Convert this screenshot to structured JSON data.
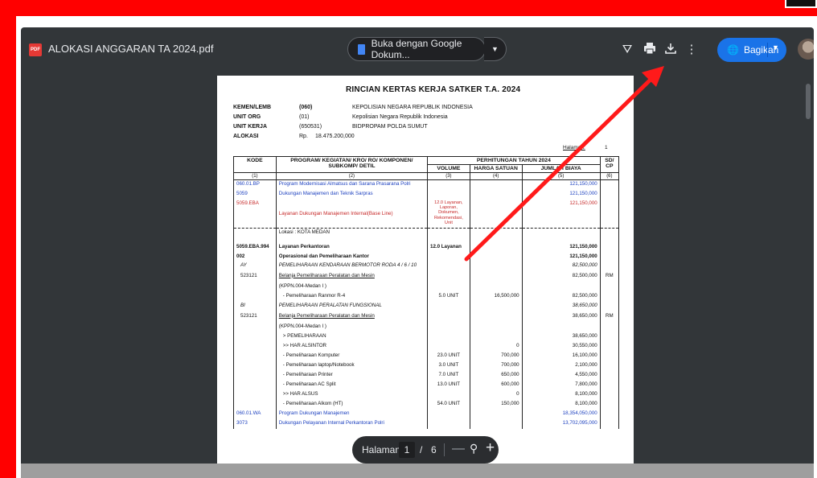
{
  "viewer": {
    "file_name": "ALOKASI ANGGARAN TA 2024.pdf",
    "open_with_label": "Buka dengan Google Dokum...",
    "share_label": "Bagikan",
    "icons": [
      "pdf-icon",
      "add-to-drive-icon",
      "print-icon",
      "download-icon",
      "more-vert-icon",
      "globe-icon",
      "avatar"
    ]
  },
  "pager": {
    "label": "Halaman",
    "current": "1",
    "separator": "/",
    "total": "6",
    "minus": "—",
    "zoom": "⚲",
    "plus": "+"
  },
  "document": {
    "title": "RINCIAN KERTAS KERJA SATKER T.A. 2024",
    "meta": [
      {
        "key": "KEMEN/LEMB",
        "code": "(060)",
        "value": "KEPOLISIAN NEGARA REPUBLIK INDONESIA"
      },
      {
        "key": "UNIT ORG",
        "code": "(01)",
        "value": "Kepolisian Negara Republik Indonesia"
      },
      {
        "key": "UNIT KERJA",
        "code": "(650531)",
        "value": "BIDPROPAM POLDA SUMUT"
      },
      {
        "key": "ALOKASI",
        "code": "Rp.",
        "value": "18.475.200,000"
      }
    ],
    "halaman_label": "Halaman:",
    "halaman_value": "1",
    "headers": {
      "kode": "KODE",
      "program": "PROGRAM/ KEGIATAN/ KRO/ RO/ KOMPONEN/ SUBKOMP/ DETIL",
      "perhitungan": "PERHITUNGAN TAHUN 2024",
      "volume": "VOLUME",
      "harga": "HARGA SATUAN",
      "jumlah": "JUMLAH BIAYA",
      "sdcp": "SD/ CP"
    },
    "col_numbers": [
      "(1)",
      "(2)",
      "(3)",
      "(4)",
      "(5)",
      "(6)"
    ],
    "rows": [
      {
        "kode": "060.01.BP",
        "program": "Program Modernisasi Almatsus dan Sarana Prasarana Polri",
        "volume": "",
        "harga": "",
        "jumlah": "121,150,000",
        "sd": ""
      },
      {
        "kode": "5059",
        "program": "Dukungan Manajemen dan Teknik Sarpras",
        "volume": "",
        "harga": "",
        "jumlah": "121,150,000",
        "sd": ""
      },
      {
        "kode": "5059.EBA",
        "program": "Layanan Dukungan Manajemen Internal(Base Line)",
        "volume": "12.0 Layanan, Laporan, Dokumen, Rekomendasi, Unit",
        "harga": "",
        "jumlah": "121,150,000",
        "sd": ""
      },
      {
        "kode": "",
        "program": "Lokasi : KOTA MEDAN",
        "volume": "",
        "harga": "",
        "jumlah": "",
        "sd": ""
      },
      {
        "kode": "5059.EBA.994",
        "program": "Layanan Perkantoran",
        "volume": "12.0 Layanan",
        "harga": "",
        "jumlah": "121,150,000",
        "sd": ""
      },
      {
        "kode": "002",
        "program": "Operasional dan Pemeliharaan Kantor",
        "volume": "",
        "harga": "",
        "jumlah": "121,150,000",
        "sd": ""
      },
      {
        "kode": "AY",
        "program": "PEMELIHARAAN KENDARAAN BERMOTOR RODA 4 / 6 / 10",
        "volume": "",
        "harga": "",
        "jumlah": "82,500,000",
        "sd": ""
      },
      {
        "kode": "523121",
        "program": "Belanja Pemeliharaan Peralatan dan Mesin",
        "volume": "",
        "harga": "",
        "jumlah": "82,500,000",
        "sd": "RM"
      },
      {
        "kode": "",
        "program": "(KPPN.004-Medan I )",
        "volume": "",
        "harga": "",
        "jumlah": "",
        "sd": ""
      },
      {
        "kode": "",
        "program": "-  Pemeliharaan Ranmor R-4",
        "volume": "5.0 UNIT",
        "harga": "16,500,000",
        "jumlah": "82,500,000",
        "sd": ""
      },
      {
        "kode": "BI",
        "program": "PEMELIHARAAN PERALATAN FUNGSIONAL",
        "volume": "",
        "harga": "",
        "jumlah": "38,650,000",
        "sd": ""
      },
      {
        "kode": "523121",
        "program": "Belanja Pemeliharaan Peralatan dan Mesin",
        "volume": "",
        "harga": "",
        "jumlah": "38,650,000",
        "sd": "RM"
      },
      {
        "kode": "",
        "program": "(KPPN.004-Medan I )",
        "volume": "",
        "harga": "",
        "jumlah": "",
        "sd": ""
      },
      {
        "kode": "",
        "program": ">   PEMELIHARAAN",
        "volume": "",
        "harga": "",
        "jumlah": "38,650,000",
        "sd": ""
      },
      {
        "kode": "",
        "program": ">>  HAR ALSINTOR",
        "volume": "",
        "harga": "0",
        "jumlah": "30,550,000",
        "sd": ""
      },
      {
        "kode": "",
        "program": "-  Pemeliharaan Komputer",
        "volume": "23.0 UNIT",
        "harga": "700,000",
        "jumlah": "16,100,000",
        "sd": ""
      },
      {
        "kode": "",
        "program": "-  Pemeliharaan laptop/Notebook",
        "volume": "3.0 UNIT",
        "harga": "700,000",
        "jumlah": "2,100,000",
        "sd": ""
      },
      {
        "kode": "",
        "program": "-  Pemeliharaan Printer",
        "volume": "7.0 UNIT",
        "harga": "650,000",
        "jumlah": "4,550,000",
        "sd": ""
      },
      {
        "kode": "",
        "program": "-  Pemeliharaan AC Split",
        "volume": "13.0 UNIT",
        "harga": "600,000",
        "jumlah": "7,800,000",
        "sd": ""
      },
      {
        "kode": "",
        "program": ">>  HAR ALSUS",
        "volume": "",
        "harga": "0",
        "jumlah": "8,100,000",
        "sd": ""
      },
      {
        "kode": "",
        "program": "-  Pemeliharaan Alkom (HT)",
        "volume": "54.0 UNIT",
        "harga": "150,000",
        "jumlah": "8,100,000",
        "sd": ""
      },
      {
        "kode": "060.01.WA",
        "program": "Program Dukungan Manajemen",
        "volume": "",
        "harga": "",
        "jumlah": "18,354,050,000",
        "sd": ""
      },
      {
        "kode": "3073",
        "program": "Dukungan Pelayanan Internal Perkantoran Polri",
        "volume": "",
        "harga": "",
        "jumlah": "13,702,095,000",
        "sd": ""
      }
    ]
  },
  "colors": {
    "frame": "#ff0000",
    "viewer_bg": "#323639",
    "accent": "#1a73e8",
    "arrow": "#ff1a1a"
  }
}
